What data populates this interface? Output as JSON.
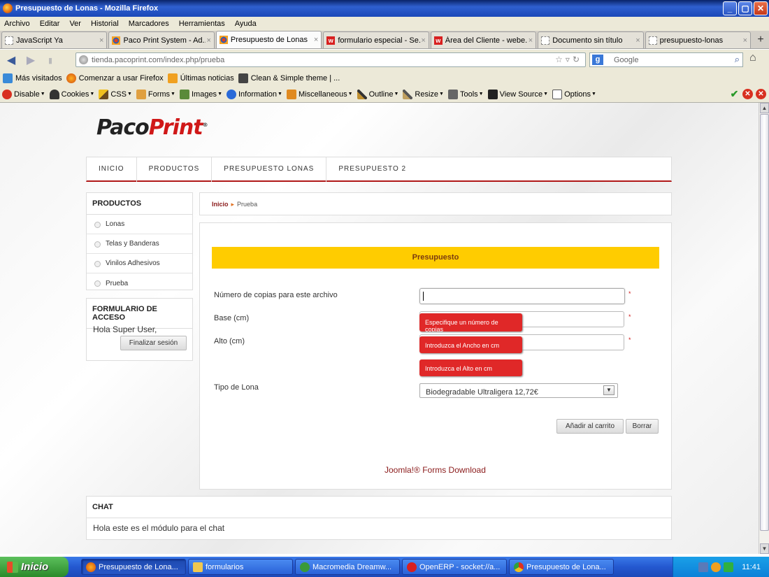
{
  "window": {
    "title": "Presupuesto de Lonas - Mozilla Firefox",
    "minimize": "_",
    "maximize": "▢",
    "close": "✕"
  },
  "menubar": [
    "Archivo",
    "Editar",
    "Ver",
    "Historial",
    "Marcadores",
    "Herramientas",
    "Ayuda"
  ],
  "tabs": [
    {
      "label": "JavaScript Ya",
      "icon": "blank"
    },
    {
      "label": "Paco Print System - Ad...",
      "icon": "joomla"
    },
    {
      "label": "Presupuesto de Lonas",
      "icon": "joomla",
      "active": true
    },
    {
      "label": "formulario especial - Se...",
      "icon": "w"
    },
    {
      "label": "Área del Cliente - webe...",
      "icon": "w"
    },
    {
      "label": "Documento sin título",
      "icon": "blank"
    },
    {
      "label": "presupuesto-lonas",
      "icon": "blank"
    }
  ],
  "new_tab": "+",
  "nav": {
    "url": "tienda.pacoprint.com/index.php/prueba",
    "search_placeholder": "Google",
    "back": "◀",
    "forward": "▶",
    "home": "⌂"
  },
  "bookmarks": [
    "Más visitados",
    "Comenzar a usar Firefox",
    "Últimas noticias",
    "Clean & Simple theme | ..."
  ],
  "devtools": [
    "Disable",
    "Cookies",
    "CSS",
    "Forms",
    "Images",
    "Information",
    "Miscellaneous",
    "Outline",
    "Resize",
    "Tools",
    "View Source",
    "Options"
  ],
  "site": {
    "logo_part1": "Paco",
    "logo_part2": "Print",
    "logo_reg": "®",
    "nav": [
      "INICIO",
      "PRODUCTOS",
      "PRESUPUESTO LONAS",
      "PRESUPUESTO 2"
    ],
    "sidebar": {
      "products_title": "PRODUCTOS",
      "products": [
        "Lonas",
        "Telas y Banderas",
        "Vinilos Adhesivos",
        "Prueba"
      ],
      "login_title": "FORMULARIO DE ACCESO",
      "greeting": "Hola Super User,",
      "logout": "Finalizar sesión"
    },
    "breadcrumb": {
      "home": "Inicio",
      "sep": "▸",
      "current": "Prueba"
    },
    "form": {
      "header": "Presupuesto",
      "copies_label": "Número de copias para este archivo",
      "base_label": "Base (cm)",
      "alto_label": "Alto (cm)",
      "tipo_label": "Tipo de Lona",
      "tipo_value": "Biodegradable Ultraligera 12,72€",
      "required_mark": "*",
      "tip_copies": "Especifique un número de copias",
      "tip_base": "Introduzca el Ancho en cm",
      "tip_alto": "Introduzca el Alto en cm",
      "add_cart": "Añadir al carrito",
      "clear": "Borrar",
      "footer_link": "Joomla!® Forms Download"
    },
    "chat": {
      "title": "CHAT",
      "text": "Hola este es el módulo para el chat"
    }
  },
  "taskbar": {
    "start": "Inicio",
    "tasks": [
      "Presupuesto de Lona...",
      "formularios",
      "Macromedia Dreamw...",
      "OpenERP - socket://a...",
      "Presupuesto de Lona..."
    ],
    "clock": "11:41"
  }
}
